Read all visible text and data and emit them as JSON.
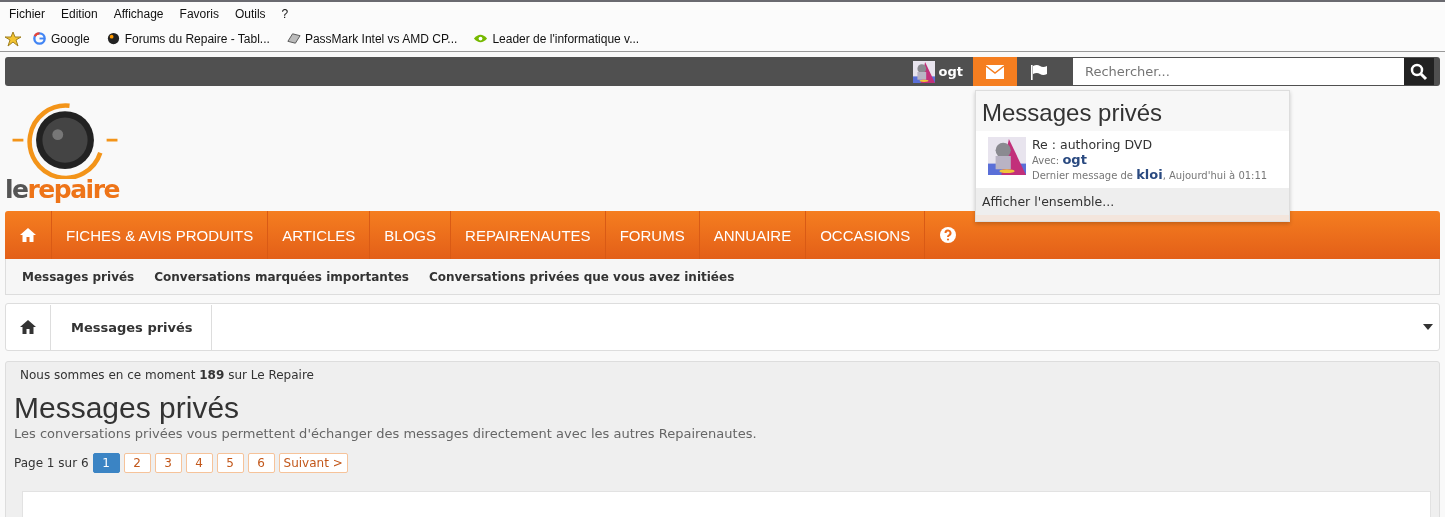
{
  "menu_bar": [
    "Fichier",
    "Edition",
    "Affichage",
    "Favoris",
    "Outils",
    "?"
  ],
  "bookmarks": [
    {
      "kind": "google",
      "label": "Google"
    },
    {
      "kind": "ball",
      "label": "Forums du Repaire - Tabl..."
    },
    {
      "kind": "chip",
      "label": "PassMark Intel vs AMD CP..."
    },
    {
      "kind": "leaf",
      "label": "Leader de l'informatique v..."
    }
  ],
  "top_bar": {
    "user": "ogt",
    "search": {
      "placeholder": "Rechercher..."
    },
    "messages_selected": true
  },
  "messages_popup": {
    "title": "Messages privés",
    "items": [
      {
        "subject": "Re : authoring DVD",
        "with_label": "Avec:",
        "with_user": "ogt",
        "last_prefix": "Dernier message de",
        "last_user": "kloi",
        "last_time": ", Aujourd'hui à 01:11"
      }
    ],
    "footer": "Afficher l'ensemble..."
  },
  "logo": {
    "word1": "le",
    "word2": "repaire"
  },
  "nav": [
    "FICHES & AVIS PRODUITS",
    "ARTICLES",
    "BLOGS",
    "REPAIRENAUTES",
    "FORUMS",
    "ANNUAIRE",
    "OCCASIONS"
  ],
  "sub_nav": [
    "Messages privés",
    "Conversations marquées importantes",
    "Conversations privées que vous avez initiées"
  ],
  "breadcrumb": [
    "Messages privés"
  ],
  "online_notice": "Nous sommes en ce moment **189** sur Le Repaire",
  "page_title": "Messages privés",
  "description": "Les conversations privées vous permettent d'échanger des messages directement avec les autres Repairenautes.",
  "pagination": {
    "label": "Page 1 sur 6",
    "pages": [
      {
        "label": "1",
        "selected": true
      },
      {
        "label": "2",
        "selected": false
      },
      {
        "label": "3",
        "selected": false
      },
      {
        "label": "4",
        "selected": false
      },
      {
        "label": "5",
        "selected": false
      },
      {
        "label": "6",
        "selected": false
      }
    ],
    "next": "Suivant >"
  }
}
